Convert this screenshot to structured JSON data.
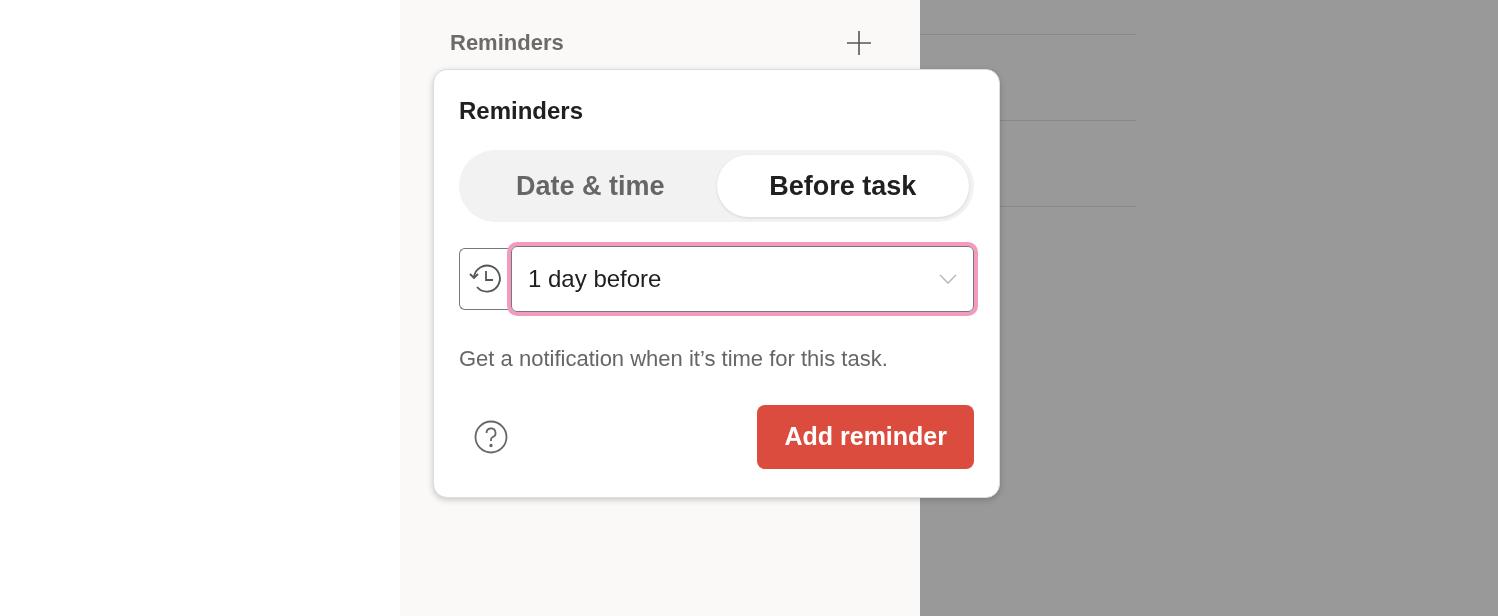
{
  "sidebar": {
    "section_title": "Reminders"
  },
  "popover": {
    "title": "Reminders",
    "tabs": [
      {
        "label": "Date & time",
        "selected": false
      },
      {
        "label": "Before task",
        "selected": true
      }
    ],
    "reminder_select": {
      "value": "1 day before",
      "focused": true
    },
    "description": "Get a notification when it’s time for this task.",
    "buttons": [
      "Add reminder"
    ]
  }
}
